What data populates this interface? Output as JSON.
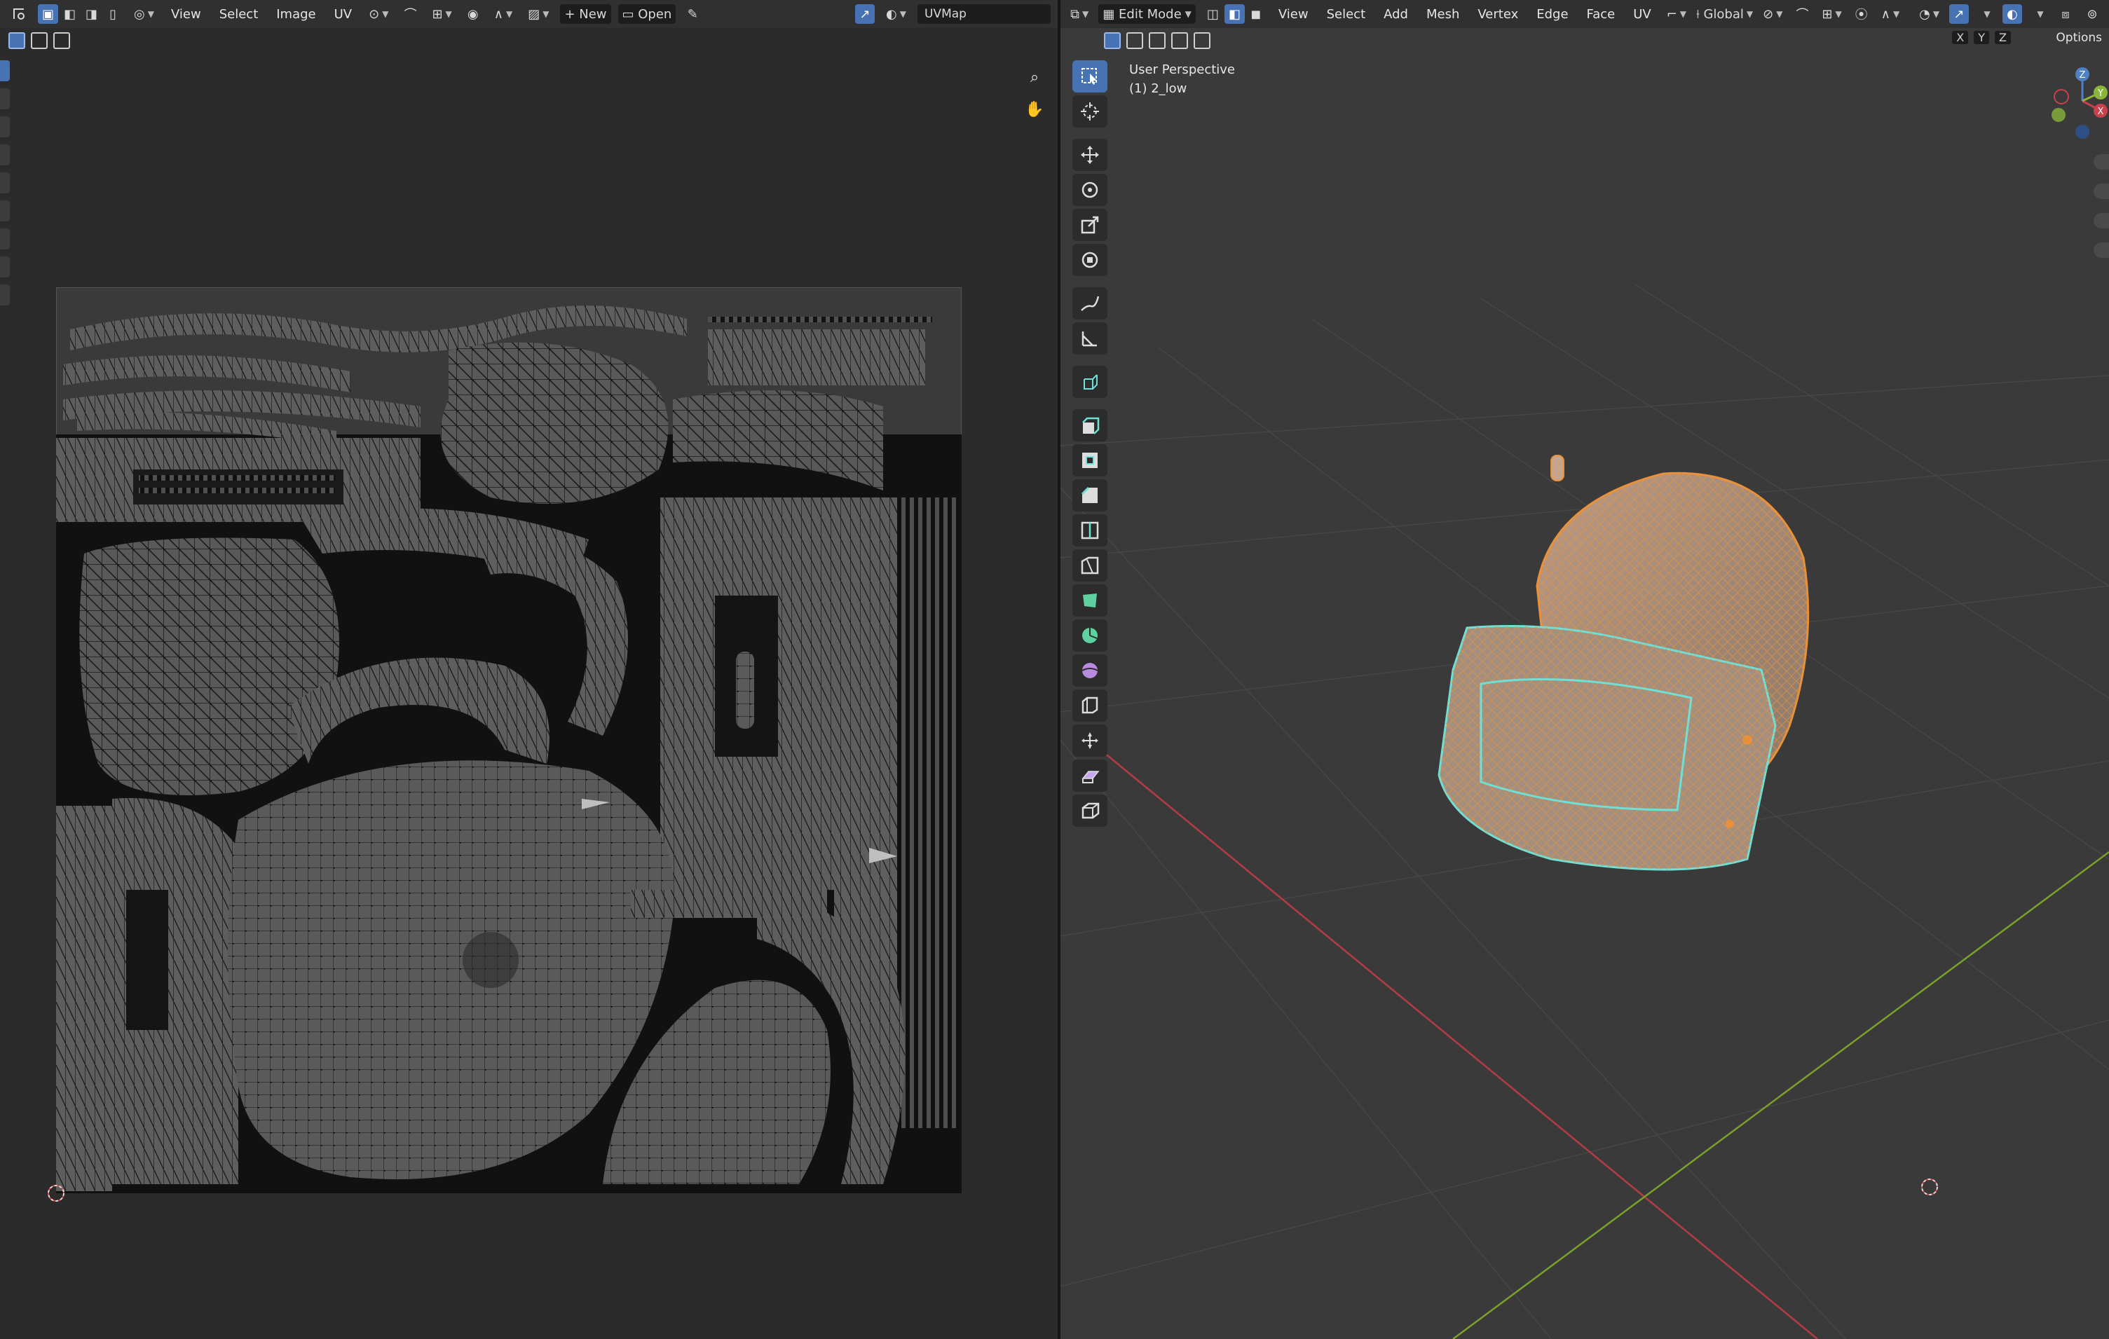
{
  "uv_editor": {
    "menus": [
      "View",
      "Select",
      "Image",
      "UV"
    ],
    "new_label": "New",
    "open_label": "Open",
    "uvmap_name": "UVMap"
  },
  "viewport": {
    "mode": "Edit Mode",
    "menus": [
      "View",
      "Select",
      "Add",
      "Mesh",
      "Vertex",
      "Edge",
      "Face",
      "UV"
    ],
    "transform_orientation": "Global",
    "overlay_title": "User Perspective",
    "object_label": "(1) 2_low",
    "options_label": "Options",
    "axis_labels": [
      "X",
      "Y",
      "Z"
    ]
  },
  "colors": {
    "accent": "#4772b3",
    "selection_orange": "#e8913a",
    "selection_teal": "#6fe0d6",
    "x_axis": "#b33c45",
    "y_axis": "#7aa12a"
  }
}
